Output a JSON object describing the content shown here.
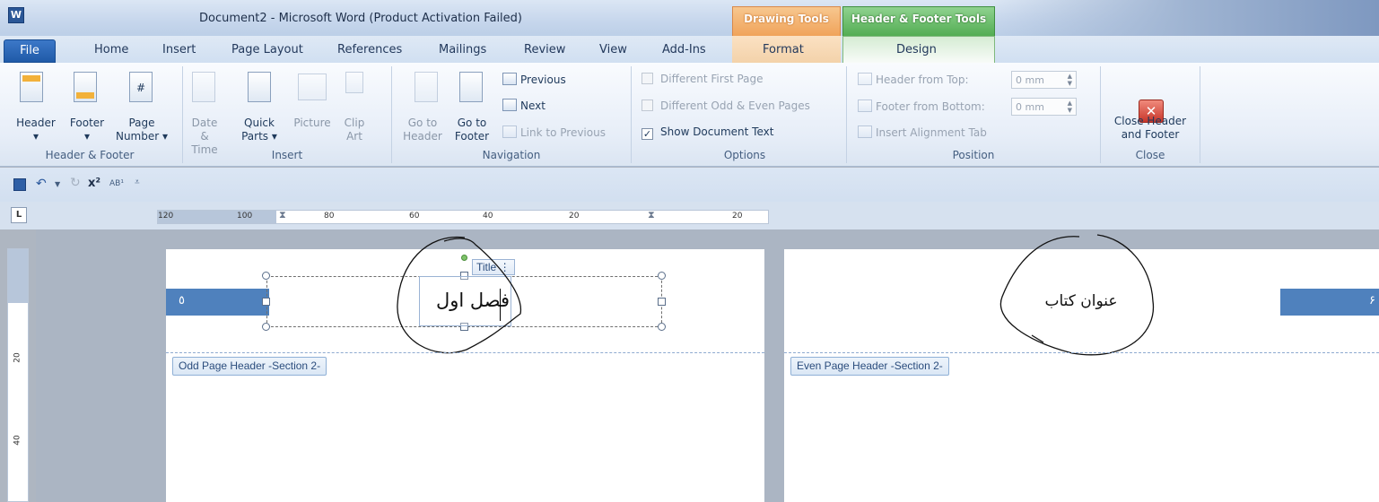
{
  "window": {
    "app_icon": "W",
    "title": "Document2 - Microsoft Word (Product Activation Failed)",
    "context_tabs": {
      "drawing_tools": "Drawing Tools",
      "header_footer_tools": "Header & Footer Tools"
    }
  },
  "tabs": [
    "File",
    "Home",
    "Insert",
    "Page Layout",
    "References",
    "Mailings",
    "Review",
    "View",
    "Add-Ins",
    "Format",
    "Design"
  ],
  "ribbon": {
    "header_footer_group": {
      "header": "Header",
      "footer": "Footer",
      "page_number_1": "Page",
      "page_number_2": "Number",
      "label": "Header & Footer"
    },
    "insert_group": {
      "date_1": "Date",
      "date_2": "& Time",
      "quick_1": "Quick",
      "quick_2": "Parts",
      "picture": "Picture",
      "clip_1": "Clip",
      "clip_2": "Art",
      "label": "Insert"
    },
    "navigation_group": {
      "goto_header_1": "Go to",
      "goto_header_2": "Header",
      "goto_footer_1": "Go to",
      "goto_footer_2": "Footer",
      "previous": "Previous",
      "next": "Next",
      "link_previous": "Link to Previous",
      "label": "Navigation"
    },
    "options_group": {
      "different_first": "Different First Page",
      "different_odd_even": "Different Odd & Even Pages",
      "show_doc_text": "Show Document Text",
      "label": "Options"
    },
    "position_group": {
      "header_from_top": "Header from Top:",
      "header_value": "0 mm",
      "footer_from_bottom": "Footer from Bottom:",
      "footer_value": "0 mm",
      "alignment_tab": "Insert Alignment Tab",
      "label": "Position"
    },
    "close_group": {
      "close_1": "Close Header",
      "close_2": "and Footer",
      "label": "Close"
    }
  },
  "ruler": {
    "marks": [
      "120",
      "100",
      "80",
      "60",
      "40",
      "20",
      "20"
    ]
  },
  "vruler": {
    "marks": [
      "20",
      "40"
    ]
  },
  "left_page": {
    "page_number": "٥",
    "title_control_label": "Title",
    "title_text": "فصل اول",
    "header_tag": "Odd Page Header -Section 2-"
  },
  "right_page": {
    "page_number": "۶",
    "book_title": "عنوان کتاب",
    "header_tag": "Even Page Header -Section 2-"
  },
  "colors": {
    "accent": "#4f81bd",
    "drawing_tools": "#f0a35a",
    "header_footer_tools": "#53ad53"
  }
}
